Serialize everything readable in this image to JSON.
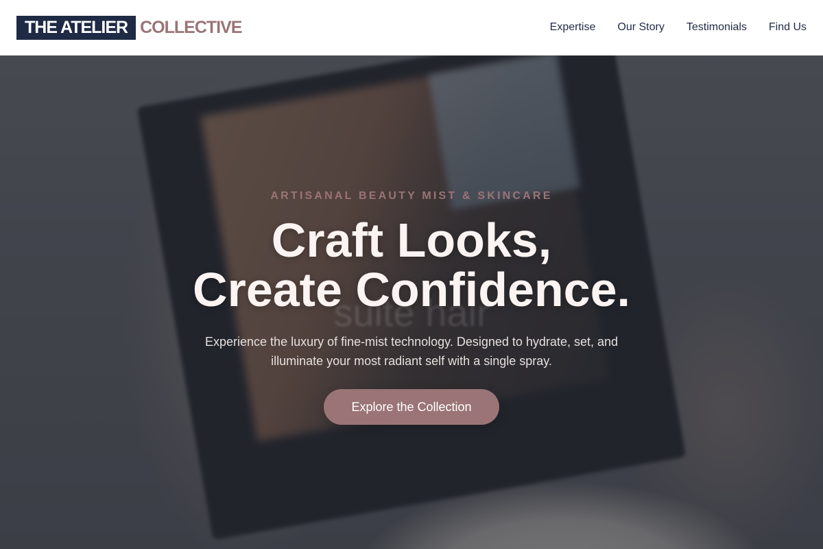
{
  "header": {
    "logo_primary": "THE ATELIER",
    "logo_secondary": "COLLECTIVE",
    "nav": [
      {
        "label": "Expertise"
      },
      {
        "label": "Our Story"
      },
      {
        "label": "Testimonials"
      },
      {
        "label": "Find Us"
      }
    ]
  },
  "hero": {
    "eyebrow": "ARTISANAL BEAUTY MIST & SKINCARE",
    "headline_line1": "Craft Looks,",
    "headline_line2": "Create Confidence.",
    "subtitle": "Experience the luxury of fine-mist technology. Designed to hydrate, set, and illuminate your most radiant self with a single spray.",
    "cta_label": "Explore the Collection",
    "background_text": "suite hair"
  },
  "colors": {
    "brand_dark": "#1f2a44",
    "brand_accent": "#9a7476",
    "headline": "#fbf4f2",
    "header_bg": "#ffffff"
  }
}
